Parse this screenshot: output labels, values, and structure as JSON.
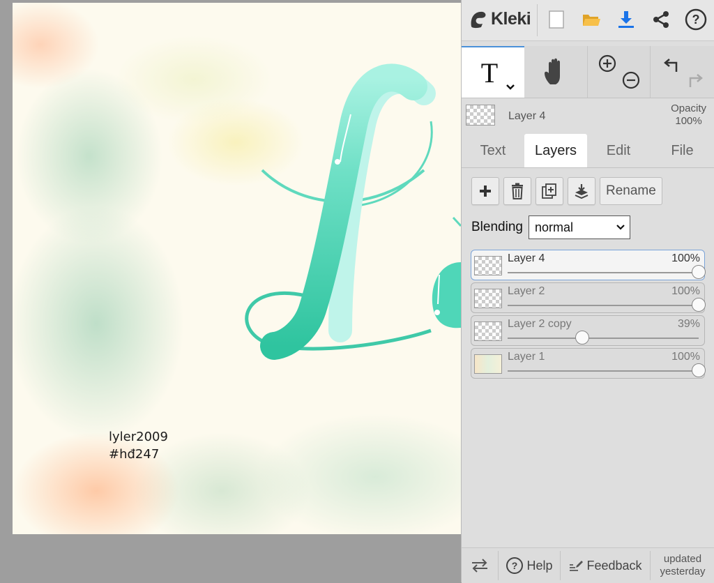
{
  "canvas": {
    "signature_line1": "lyler2009",
    "signature_line2": "#hđ247"
  },
  "topbar": {
    "logo_text": "Kleki",
    "buttons": [
      "new-image-icon",
      "open-folder-icon",
      "download-icon",
      "share-icon",
      "help-icon"
    ]
  },
  "tools": [
    "text-tool-icon",
    "hand-tool-icon",
    "zoom-icon",
    "undo-redo-icon"
  ],
  "current_layer": {
    "name": "Layer 4",
    "opacity_label": "Opacity",
    "opacity_value": "100%"
  },
  "tabs": {
    "text": "Text",
    "layers": "Layers",
    "edit": "Edit",
    "file": "File"
  },
  "layer_buttons": {
    "rename": "Rename"
  },
  "blending": {
    "label": "Blending",
    "value": "normal"
  },
  "layers": [
    {
      "name": "Layer 4",
      "opacity": "100%",
      "fraction": 1.0,
      "selected": true
    },
    {
      "name": "Layer 2",
      "opacity": "100%",
      "fraction": 1.0,
      "selected": false
    },
    {
      "name": "Layer 2 copy",
      "opacity": "39%",
      "fraction": 0.39,
      "selected": false
    },
    {
      "name": "Layer 1",
      "opacity": "100%",
      "fraction": 1.0,
      "selected": false
    }
  ],
  "bottombar": {
    "help": "Help",
    "feedback": "Feedback",
    "updated_line1": "updated",
    "updated_line2": "yesterday"
  },
  "colors": {
    "accent": "#4a90d9",
    "brush_teal": "#4fd6b8",
    "download_blue": "#1a73e8",
    "folder_yellow": "#f5b83a"
  }
}
